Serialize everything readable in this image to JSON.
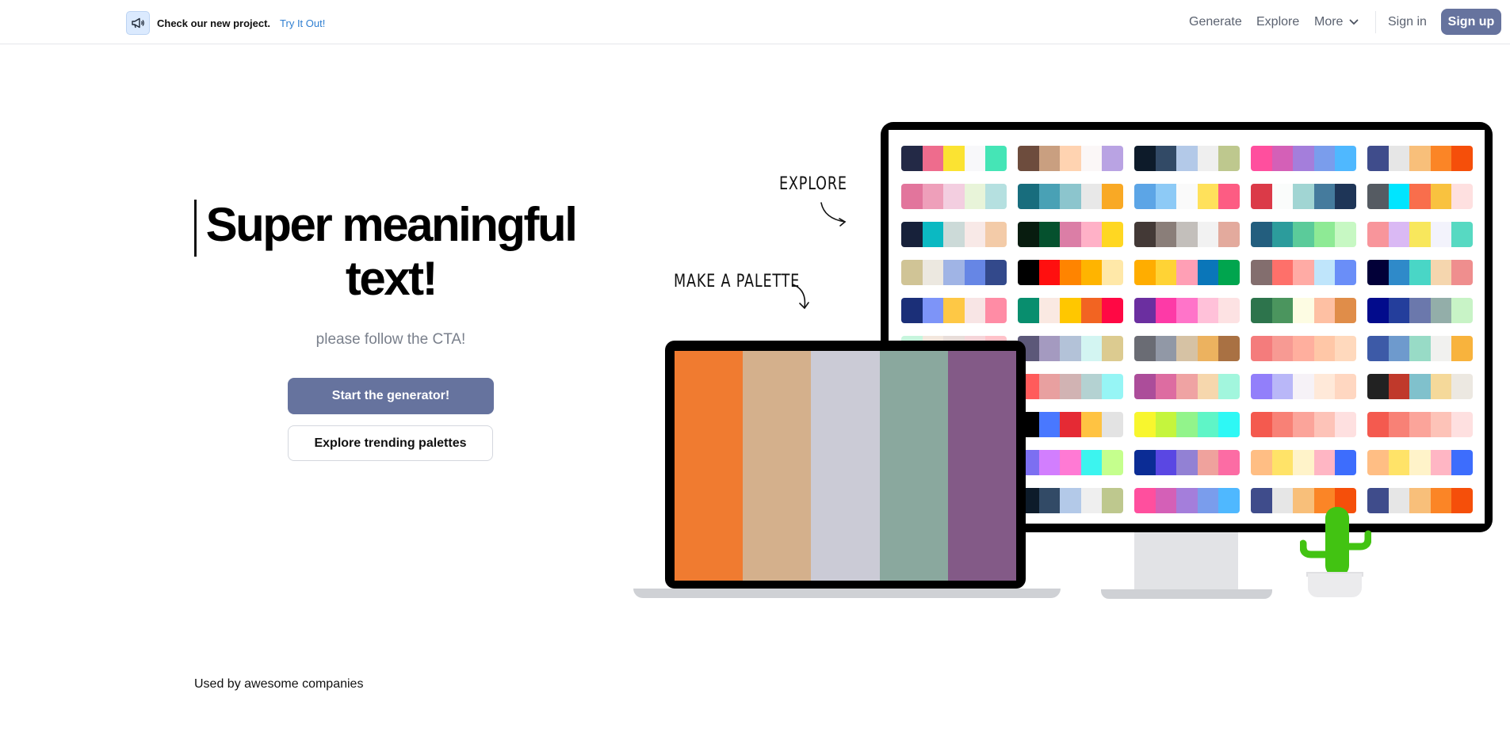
{
  "announcement": {
    "text": "Check our new project.",
    "link": "Try It Out!"
  },
  "nav": {
    "generate": "Generate",
    "explore": "Explore",
    "more": "More",
    "sign_in": "Sign in",
    "sign_up": "Sign up"
  },
  "hero": {
    "title": "Super meaningful text!",
    "subtitle": "please follow the CTA!",
    "primary_cta": "Start the generator!",
    "secondary_cta": "Explore trending palettes"
  },
  "illustration": {
    "explore_label": "EXPLORE",
    "make_palette_label": "MAKE A PALETTE",
    "laptop_palette": [
      "#f07b30",
      "#d4b08c",
      "#cbcbd6",
      "#8aa89e",
      "#835a87"
    ],
    "monitor_palettes": [
      [
        "#232946",
        "#ee6c8d",
        "#fbe332",
        "#f8f8fa",
        "#45e5b6"
      ],
      [
        "#6d4c3d",
        "#c99f80",
        "#ffd3b1",
        "#fbf7f7",
        "#b9a3e3"
      ],
      [
        "#0d1b2a",
        "#324a66",
        "#b3c9e8",
        "#efefef",
        "#bec88e"
      ],
      [
        "#ff4f9e",
        "#d460b7",
        "#a47edb",
        "#7a9dec",
        "#4fb8ff"
      ],
      [
        "#3f4c8b",
        "#e6e6e6",
        "#f8bf7a",
        "#fb8526",
        "#f54f0a"
      ],
      [
        "#e2759c",
        "#ee9fba",
        "#f3cee0",
        "#e8f4d9",
        "#b5e0e0"
      ],
      [
        "#186d7d",
        "#49a1b5",
        "#8cc5cd",
        "#e8e8e8",
        "#f9a925"
      ],
      [
        "#5ca5e6",
        "#8dcaf6",
        "#fafafa",
        "#ffe15b",
        "#fd5c83"
      ],
      [
        "#db3a48",
        "#fafcfb",
        "#a1d5d3",
        "#457b9d",
        "#1e3557"
      ],
      [
        "#555b62",
        "#00e5ff",
        "#f96e4c",
        "#f9c23f",
        "#fee0e0"
      ],
      [
        "#17213a",
        "#0bb9c2",
        "#ccdad8",
        "#f8e9e7",
        "#f3cba8"
      ],
      [
        "#081c0f",
        "#05512e",
        "#db7ea6",
        "#ffb1c7",
        "#ffd722"
      ],
      [
        "#433936",
        "#8a7e79",
        "#c3bfbb",
        "#f2f2f2",
        "#e3aa9d"
      ],
      [
        "#235e7e",
        "#2c9c9c",
        "#5bcb9a",
        "#8eea95",
        "#c7f8c3"
      ],
      [
        "#f8959b",
        "#dab9f4",
        "#f8e75c",
        "#f3f3fc",
        "#57d9c2"
      ],
      [
        "#d0c496",
        "#ece8e0",
        "#a0b4e5",
        "#6686e5",
        "#33498b"
      ],
      [
        "#000000",
        "#ff0f0f",
        "#ff8400",
        "#ffb400",
        "#ffe8a8"
      ],
      [
        "#ffad00",
        "#ffd335",
        "#ff9fb5",
        "#0a76b9",
        "#00a54e"
      ],
      [
        "#836e6e",
        "#fe706a",
        "#ffaba5",
        "#bfe5fb",
        "#6a8ef8"
      ],
      [
        "#020038",
        "#2f8ac9",
        "#49d6c6",
        "#f5d6ae",
        "#ef8e8e"
      ],
      [
        "#1b2f78",
        "#7d94f8",
        "#fec845",
        "#f8e5e5",
        "#ff8ca5"
      ],
      [
        "#088e6e",
        "#fae9e2",
        "#ffc700",
        "#f26422",
        "#ff0844"
      ],
      [
        "#6b2fa0",
        "#fd3aa7",
        "#ff74c9",
        "#ffc1d9",
        "#fde2e3"
      ],
      [
        "#2d744c",
        "#4b955e",
        "#fdfce3",
        "#fec0a3",
        "#e08d49"
      ],
      [
        "#020b8c",
        "#243e9c",
        "#6b78ac",
        "#93aea9",
        "#c8f3c6"
      ],
      [
        "#c7f5dd",
        "#f3e7dd",
        "#e8ddd9",
        "#f5d5d9",
        "#ffc2c9"
      ],
      [
        "#5c5879",
        "#a49ac0",
        "#b3c2d8",
        "#d3f5f2",
        "#dccb90"
      ],
      [
        "#6a6c74",
        "#9198a6",
        "#d6c2a4",
        "#ecb25f",
        "#a97143"
      ],
      [
        "#f47c7c",
        "#f79a93",
        "#ffaf9e",
        "#ffc7a7",
        "#ffd9bd"
      ],
      [
        "#3d5aa7",
        "#6e9acd",
        "#98dbc6",
        "#f1f1ef",
        "#f8b33d"
      ],
      [
        "#ff5b5b",
        "#f09d9d",
        "#d1b3b3",
        "#b4d2d2",
        "#96f5f5"
      ],
      [
        "#ff5b5b",
        "#e8a0a0",
        "#d1b3b3",
        "#b4d2d2",
        "#96f5f5"
      ],
      [
        "#ac4d9a",
        "#dd6ca1",
        "#efa3a3",
        "#f6d7ad",
        "#a2f6dd"
      ],
      [
        "#927ffa",
        "#b9b7f8",
        "#f6f2f7",
        "#ffe9d9",
        "#ffd7c1"
      ],
      [
        "#222222",
        "#c0392b",
        "#80c1cc",
        "#f5d99a",
        "#ece8e1"
      ],
      [
        "#8de0ef",
        "#ffad3c",
        "#ffd54e",
        "#5a8a35",
        "#0e4813"
      ],
      [
        "#000000",
        "#4978ff",
        "#e52a34",
        "#ffc342",
        "#e3e3e3"
      ],
      [
        "#f8f62e",
        "#c5f53d",
        "#92f48b",
        "#5ff5c7",
        "#2ef8f5"
      ],
      [
        "#f45a4f",
        "#f88176",
        "#fba49a",
        "#fdc3b8",
        "#fee0e0"
      ],
      [
        "#f45a4f",
        "#f88176",
        "#fba49a",
        "#fdc3b8",
        "#fee0e0"
      ],
      [
        "#0c1cd6",
        "#2393ff",
        "#a4cff8",
        "#fff306",
        "#ffc300"
      ],
      [
        "#7c6ff1",
        "#d27efe",
        "#ff7ad4",
        "#3cf4ef",
        "#c5ff8d"
      ],
      [
        "#0b2c95",
        "#5a47e3",
        "#9281d4",
        "#efa29d",
        "#fc6ca4"
      ],
      [
        "#ffbe84",
        "#ffe368",
        "#fff3c9",
        "#ffb6c4",
        "#3d6dfd"
      ],
      [
        "#ffbe84",
        "#ffe368",
        "#fff3c9",
        "#ffb6c4",
        "#3d6dfd"
      ],
      [
        "#6d4c3d",
        "#c99f80",
        "#ffd3b1",
        "#fbf7f7",
        "#b9a3e3"
      ],
      [
        "#0d1b2a",
        "#324a66",
        "#b3c9e8",
        "#efefef",
        "#bec88e"
      ],
      [
        "#ff4f9e",
        "#d460b7",
        "#a47edb",
        "#7a9dec",
        "#4fb8ff"
      ],
      [
        "#3f4c8b",
        "#e6e6e6",
        "#f8bf7a",
        "#fb8526",
        "#f54f0a"
      ],
      [
        "#3f4c8b",
        "#e6e6e6",
        "#f8bf7a",
        "#fb8526",
        "#f54f0a"
      ],
      [
        "#186d7d",
        "#49a1b5",
        "#8cc5cd",
        "#e8e8e8",
        "#f9a925"
      ],
      [
        "#5ca5e6",
        "#8dcaf6",
        "#fafafa",
        "#ffe15b",
        "#fd5c83"
      ],
      [
        "#db3a48",
        "#fafcfb",
        "#a1d5d3",
        "#457b9d",
        "#1e3557"
      ],
      [
        "#555b62",
        "#00e5ff",
        "#f96e4c",
        "#f9c23f",
        "#fee0e0"
      ],
      [
        "#555b62",
        "#00e5ff",
        "#f96e4c",
        "#f9c23f",
        "#fee0e0"
      ]
    ]
  },
  "companies": {
    "label": "Used by awesome companies"
  }
}
